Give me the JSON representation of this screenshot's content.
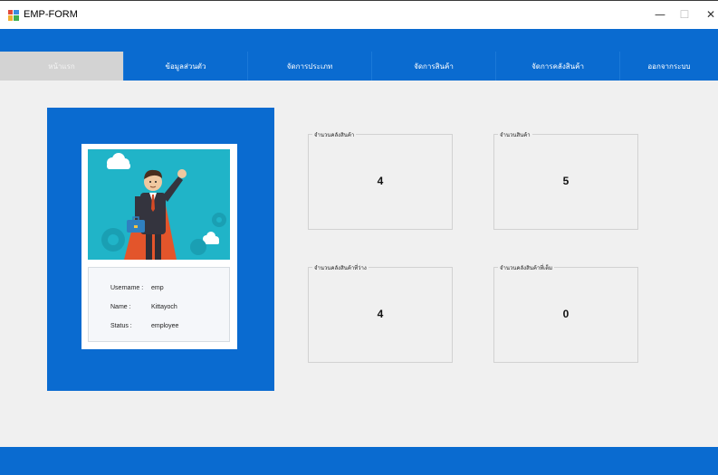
{
  "window": {
    "title": "EMP-FORM",
    "minimize": "—",
    "maximize": "☐",
    "close": "✕"
  },
  "nav": {
    "items": [
      {
        "label": "หน้าแรก",
        "active": true
      },
      {
        "label": "ข้อมูลส่วนตัว",
        "active": false
      },
      {
        "label": "จัดการประเภท",
        "active": false
      },
      {
        "label": "จัดการสินค้า",
        "active": false
      },
      {
        "label": "จัดการคลังสินค้า",
        "active": false
      },
      {
        "label": "ออกจากระบบ",
        "active": false
      }
    ]
  },
  "profile": {
    "username_label": "Username :",
    "username": "emp",
    "name_label": "Name :",
    "name": "Kittayoch",
    "status_label": "Status :",
    "status": "employee"
  },
  "stats": [
    {
      "label": "จำนวนคลังสินค้า",
      "value": "4"
    },
    {
      "label": "จำนวนสินค้า",
      "value": "5"
    },
    {
      "label": "จำนวนคลังสินค้าที่ว่าง",
      "value": "4"
    },
    {
      "label": "จำนวนคลังสินค้าที่เต็ม",
      "value": "0"
    }
  ],
  "colors": {
    "primary": "#0a6bd0",
    "nav_active": "#d3d3d3",
    "background": "#f0f0f0"
  }
}
